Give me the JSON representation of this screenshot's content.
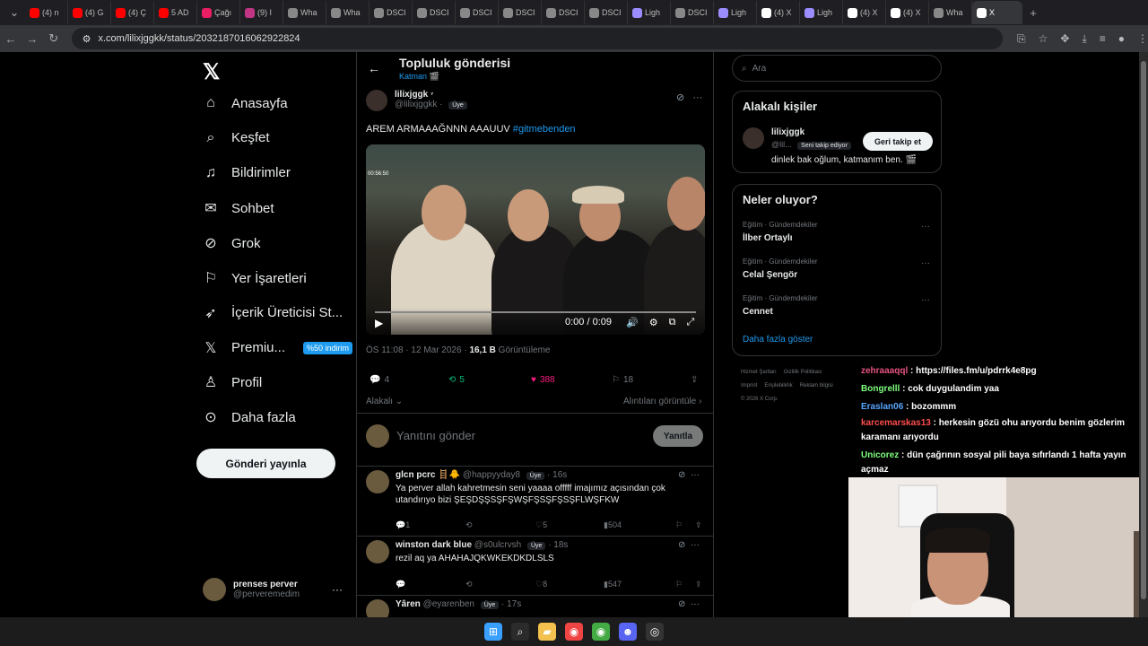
{
  "browser": {
    "tabs": [
      {
        "label": "(4) n",
        "icon": "youtube-icon",
        "color": "#ff0000"
      },
      {
        "label": "(4) G",
        "icon": "youtube-icon",
        "color": "#ff0000"
      },
      {
        "label": "(4) Ç",
        "icon": "youtube-icon",
        "color": "#ff0000"
      },
      {
        "label": "5 AD",
        "icon": "youtube-icon",
        "color": "#ff0000"
      },
      {
        "label": "Çağı",
        "icon": "music-icon",
        "color": "#e91e63"
      },
      {
        "label": "(9) I",
        "icon": "instagram-icon",
        "color": "#c13584"
      },
      {
        "label": "Wha",
        "icon": "globe-icon",
        "color": "#888888"
      },
      {
        "label": "Wha",
        "icon": "globe-icon",
        "color": "#888888"
      },
      {
        "label": "DSCI",
        "icon": "globe-icon",
        "color": "#888888"
      },
      {
        "label": "DSCI",
        "icon": "globe-icon",
        "color": "#888888"
      },
      {
        "label": "DSCI",
        "icon": "globe-icon",
        "color": "#888888"
      },
      {
        "label": "DSCI",
        "icon": "globe-icon",
        "color": "#888888"
      },
      {
        "label": "DSCI",
        "icon": "globe-icon",
        "color": "#888888"
      },
      {
        "label": "DSCI",
        "icon": "globe-icon",
        "color": "#888888"
      },
      {
        "label": "Ligh",
        "icon": "feather-icon",
        "color": "#9b8cff"
      },
      {
        "label": "DSCI",
        "icon": "globe-icon",
        "color": "#888888"
      },
      {
        "label": "Ligh",
        "icon": "feather-icon",
        "color": "#9b8cff"
      },
      {
        "label": "(4) X",
        "icon": "x-icon",
        "color": "#ffffff"
      },
      {
        "label": "Ligh",
        "icon": "feather-icon",
        "color": "#9b8cff"
      },
      {
        "label": "(4) X",
        "icon": "x-icon",
        "color": "#ffffff"
      },
      {
        "label": "(4) X",
        "icon": "x-icon",
        "color": "#ffffff"
      },
      {
        "label": "Wha",
        "icon": "globe-icon",
        "color": "#888888"
      },
      {
        "label": "X",
        "icon": "x-icon",
        "color": "#ffffff",
        "active": true
      }
    ],
    "url": "x.com/lilixjggkk/status/2032187016062922824"
  },
  "nav": {
    "items": [
      {
        "label": "Anasayfa",
        "icon": "home-icon",
        "glyph": "⌂"
      },
      {
        "label": "Keşfet",
        "icon": "search-icon",
        "glyph": "⌕"
      },
      {
        "label": "Bildirimler",
        "icon": "bell-icon",
        "glyph": "♫"
      },
      {
        "label": "Sohbet",
        "icon": "mail-icon",
        "glyph": "✉"
      },
      {
        "label": "Grok",
        "icon": "grok-icon",
        "glyph": "⊘"
      },
      {
        "label": "Yer İşaretleri",
        "icon": "bookmark-icon",
        "glyph": "⚐"
      },
      {
        "label": "İçerik Üreticisi St...",
        "icon": "rocket-icon",
        "glyph": "➶"
      },
      {
        "label": "Premiu...",
        "icon": "x-icon",
        "glyph": "𝕏",
        "badge": "%50 indirim"
      },
      {
        "label": "Profil",
        "icon": "person-icon",
        "glyph": "♙"
      },
      {
        "label": "Daha fazla",
        "icon": "more-icon",
        "glyph": "⊙"
      }
    ],
    "post_button": "Gönderi yayınla",
    "account": {
      "name": "prenses perver",
      "handle": "@perveremedim"
    }
  },
  "post": {
    "header_title": "Topluluk gönderisi",
    "header_sub": "Katman 🎬",
    "author_name": "lilixjggk",
    "author_handle": "@lilixjggkk",
    "member_pill": "Üye",
    "text": "AREM ARMAAAĞNNN AAAUUV",
    "hashtag": "#gitmebenden",
    "video_timestamp": "00:56:50",
    "video_time": "0:00 / 0:09",
    "time": "ÖS 11:08 · 12 Mar 2026 · ",
    "views": "16,1 B",
    "views_label": " Görüntüleme",
    "replies": "4",
    "reposts": "5",
    "likes": "388",
    "bookmarks": "18",
    "relevant": "Alakalı",
    "quotes": "Alıntıları görüntüle",
    "reply_placeholder": "Yanıtını gönder",
    "reply_button": "Yanıtla"
  },
  "comments": [
    {
      "name": "glcn pcrc 🪜🐥",
      "handle": "@happyyday8",
      "time": "· 16s",
      "text": "Ya perver allah kahretmesin seni yaaaa offfff imajımız açısından çok utandırıyo bizi ŞEŞDŞŞSŞFŞWŞFŞSŞFŞSŞFLWŞFKW",
      "replies": "1",
      "likes": "5",
      "views": "504"
    },
    {
      "name": "winston dark blue",
      "handle": "@s0ulcrvsh",
      "time": "· 18s",
      "text": "rezil aq ya AHAHAJQKWKEKDKDLSLS",
      "replies": "",
      "likes": "8",
      "views": "547"
    },
    {
      "name": "Yâren",
      "handle": "@eyarenben",
      "time": "· 17s",
      "text": "",
      "replies": "",
      "likes": "",
      "views": ""
    }
  ],
  "sidebar": {
    "search_placeholder": "Ara",
    "people_title": "Alakalı kişiler",
    "person_name": "lilixjggk",
    "person_handle": "@lil...",
    "person_follows": "Seni takip ediyor",
    "person_bio": "dinlek bak oğlum, katmanım ben. 🎬",
    "follow_button": "Geri takip et",
    "trends_title": "Neler oluyor?",
    "trends": [
      {
        "category": "Eğitim · Gündemdekiler",
        "name": "İlber Ortaylı"
      },
      {
        "category": "Eğitim · Gündemdekiler",
        "name": "Celal Şengör"
      },
      {
        "category": "Eğitim · Gündemdekiler",
        "name": "Cennet"
      }
    ],
    "show_more": "Daha fazla göster",
    "footer": [
      "Hizmet Şartları",
      "Gizlilik Politikası",
      "Imprint",
      "Erişilebilirlik",
      "Reklam bilgisi",
      "© 2026 X Corp."
    ]
  },
  "stream_chat": [
    {
      "user": "zehraaaqql",
      "color": "#e75480",
      "msg": ": https://files.fm/u/pdrrk4e8pg"
    },
    {
      "user": "Bongrelll",
      "color": "#7fff7f",
      "msg": ": cok duygulandim yaa"
    },
    {
      "user": "Eraslan06",
      "color": "#58a6ff",
      "msg": ": bozommm"
    },
    {
      "user": "karcemarskas13",
      "color": "#ff4d4d",
      "msg": ": herkesin gözü ohu arıyordu benim gözlerim karamanı arıyordu"
    },
    {
      "user": "Unicorez",
      "color": "#7fff7f",
      "msg": ": dün çağrının sosyal pili baya sıfırlandı 1 hafta yayın açmaz"
    }
  ],
  "taskbar": [
    {
      "icon": "windows-icon",
      "color": "#3aa0ff",
      "glyph": "⊞"
    },
    {
      "icon": "search-icon",
      "color": "#2b2b2b",
      "glyph": "⌕"
    },
    {
      "icon": "folder-icon",
      "color": "#f2c14e",
      "glyph": "▰"
    },
    {
      "icon": "chrome-icon",
      "color": "#e44",
      "glyph": "◉"
    },
    {
      "icon": "chrome-icon",
      "color": "#4a4",
      "glyph": "◉"
    },
    {
      "icon": "discord-icon",
      "color": "#5865f2",
      "glyph": "☻"
    },
    {
      "icon": "obs-icon",
      "color": "#333",
      "glyph": "◎"
    }
  ]
}
